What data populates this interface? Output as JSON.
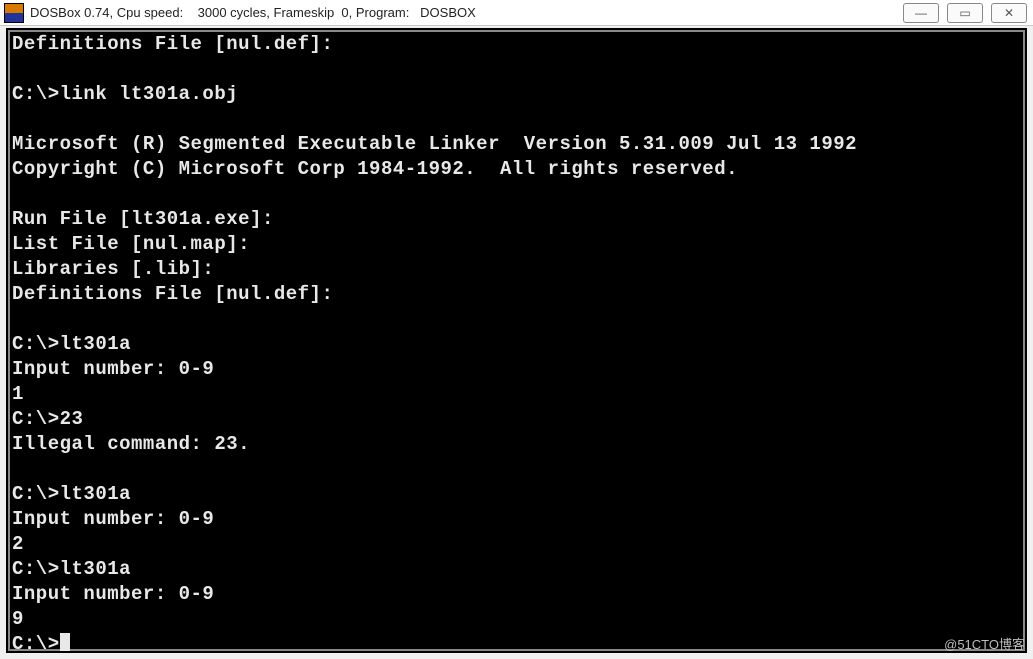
{
  "window": {
    "title": "DOSBox 0.74, Cpu speed:    3000 cycles, Frameskip  0, Program:   DOSBOX",
    "buttons": {
      "min": "—",
      "max": "▭",
      "close": "✕"
    }
  },
  "terminal": {
    "lines": [
      "Definitions File [nul.def]:",
      "",
      "C:\\>link lt301a.obj",
      "",
      "Microsoft (R) Segmented Executable Linker  Version 5.31.009 Jul 13 1992",
      "Copyright (C) Microsoft Corp 1984-1992.  All rights reserved.",
      "",
      "Run File [lt301a.exe]:",
      "List File [nul.map]:",
      "Libraries [.lib]:",
      "Definitions File [nul.def]:",
      "",
      "C:\\>lt301a",
      "Input number: 0-9",
      "1",
      "C:\\>23",
      "Illegal command: 23.",
      "",
      "C:\\>lt301a",
      "Input number: 0-9",
      "2",
      "C:\\>lt301a",
      "Input number: 0-9",
      "9"
    ],
    "prompt": "C:\\>"
  },
  "watermark": "@51CTO博客"
}
